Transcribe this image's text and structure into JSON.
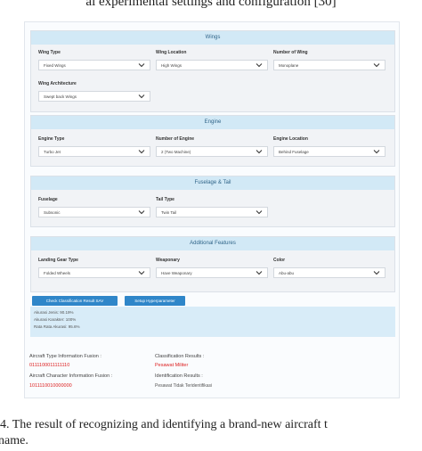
{
  "captions": {
    "top": "al experimental settings and configuration [30]",
    "bottom_line1": "4.   The result of recognizing and identifying a brand-new aircraft t",
    "bottom_line2": "name."
  },
  "sections": {
    "wings": {
      "title": "Wings",
      "fields": [
        {
          "label": "Wing Type",
          "value": "Fixed Wings"
        },
        {
          "label": "Wing Location",
          "value": "High Wings"
        },
        {
          "label": "Number of Wing",
          "value": "Monoplane"
        },
        {
          "label": "Wing Architecture",
          "value": "Swept back Wings"
        }
      ]
    },
    "engine": {
      "title": "Engine",
      "fields": [
        {
          "label": "Engine Type",
          "value": "Turbo Jet"
        },
        {
          "label": "Number of Engine",
          "value": "2 (Two Machine)"
        },
        {
          "label": "Engine Location",
          "value": "Behind Fuselage"
        }
      ]
    },
    "fuselage": {
      "title": "Fuselage & Tail",
      "fields": [
        {
          "label": "Fuselage",
          "value": "Subsonic"
        },
        {
          "label": "Tail Type",
          "value": "Twin Tail"
        }
      ]
    },
    "features": {
      "title": "Additional Features",
      "fields": [
        {
          "label": "Landing Gear Type",
          "value": "Folded Wheels"
        },
        {
          "label": "Weaponary",
          "value": "Have Weaponary"
        },
        {
          "label": "Color",
          "value": "Abu-abu"
        }
      ]
    }
  },
  "buttons": {
    "check": "Check Classification Result SAV",
    "setup": "Setup Hyperparameter"
  },
  "accuracy": {
    "line1": "Akurasi Jenis: 90.19%",
    "line2": "Akurasi Karakter: 100%",
    "line3": "Rata Rata Akurasi: 95.6%"
  },
  "results": {
    "type_label": "Aircraft Type Information Fusion :",
    "type_value": "0111100011111110",
    "char_label": "Aircraft Character Information Fusion :",
    "char_value": "1011110010000000",
    "class_label": "Classification Results :",
    "class_value": "Pesawat Militer",
    "ident_label": "Identification Results :",
    "ident_value": "Pesawat Tidak Teridentifikasi"
  },
  "colors": {
    "section_header_bg": "#d2e9f6",
    "button_bg": "#2f86c9",
    "result_value_red": "#dd2222"
  },
  "icons": {
    "select_arrow": "chevron-down-icon"
  }
}
